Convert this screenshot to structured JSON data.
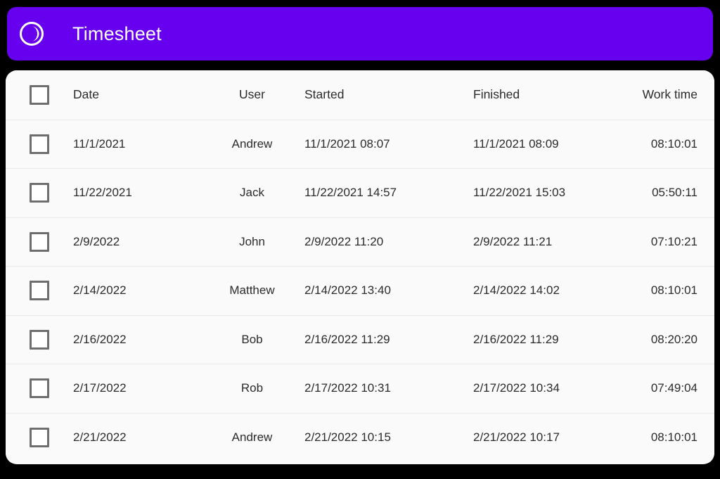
{
  "header": {
    "title": "Timesheet",
    "logo_icon": "clock-pie-icon",
    "background_color": "#6600EE",
    "text_color": "#FFFFFF"
  },
  "table": {
    "select_all_checkbox": {
      "name": "select-all-checkbox",
      "checked": false
    },
    "columns": [
      {
        "key": "check",
        "label": ""
      },
      {
        "key": "date",
        "label": "Date"
      },
      {
        "key": "user",
        "label": "User"
      },
      {
        "key": "started",
        "label": "Started"
      },
      {
        "key": "finished",
        "label": "Finished"
      },
      {
        "key": "worktime",
        "label": "Work time"
      }
    ],
    "rows": [
      {
        "checked": false,
        "date": "11/1/2021",
        "user": "Andrew",
        "started": "11/1/2021 08:07",
        "finished": "11/1/2021 08:09",
        "worktime": "08:10:01"
      },
      {
        "checked": false,
        "date": "11/22/2021",
        "user": "Jack",
        "started": "11/22/2021 14:57",
        "finished": "11/22/2021 15:03",
        "worktime": "05:50:11"
      },
      {
        "checked": false,
        "date": "2/9/2022",
        "user": "John",
        "started": "2/9/2022 11:20",
        "finished": "2/9/2022 11:21",
        "worktime": "07:10:21"
      },
      {
        "checked": false,
        "date": "2/14/2022",
        "user": "Matthew",
        "started": "2/14/2022 13:40",
        "finished": "2/14/2022 14:02",
        "worktime": "08:10:01"
      },
      {
        "checked": false,
        "date": "2/16/2022",
        "user": "Bob",
        "started": "2/16/2022 11:29",
        "finished": "2/16/2022 11:29",
        "worktime": "08:20:20"
      },
      {
        "checked": false,
        "date": "2/17/2022",
        "user": "Rob",
        "started": "2/17/2022 10:31",
        "finished": "2/17/2022 10:34",
        "worktime": "07:49:04"
      },
      {
        "checked": false,
        "date": "2/21/2022",
        "user": "Andrew",
        "started": "2/21/2022 10:15",
        "finished": "2/21/2022 10:17",
        "worktime": "08:10:01"
      }
    ]
  },
  "colors": {
    "accent": "#6600EE",
    "card_background": "#FAFAFA",
    "page_background": "#000000",
    "row_divider": "#E9E9E9",
    "text_primary": "#2B2B2B",
    "text_muted": "#808080",
    "checkbox_border": "#6E6E6E"
  }
}
